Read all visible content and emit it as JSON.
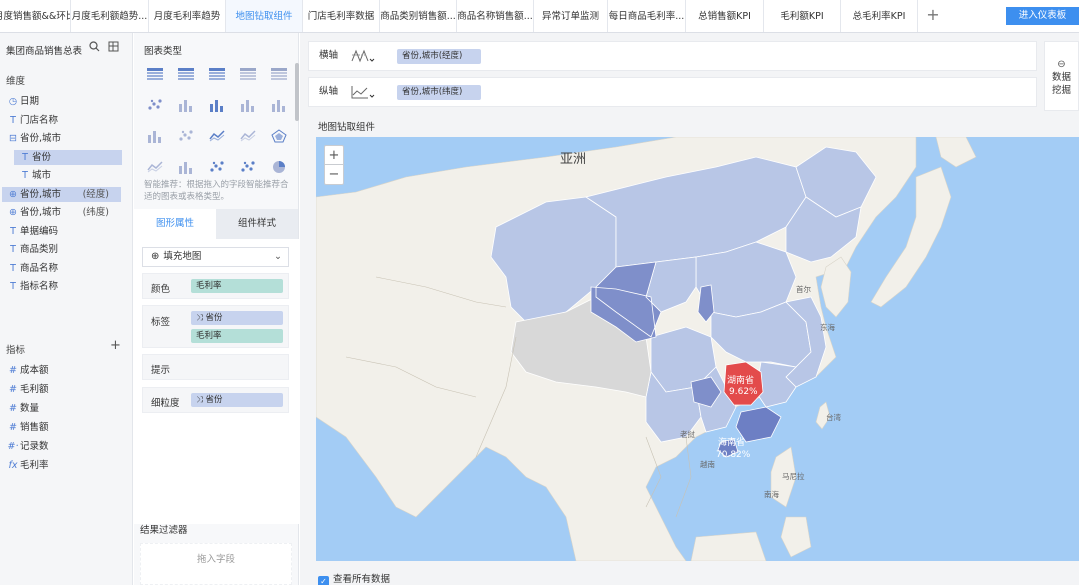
{
  "tabs": [
    {
      "label": "月度销售额&&环比",
      "active": false
    },
    {
      "label": "月度毛利额趋势...",
      "active": false
    },
    {
      "label": "月度毛利率趋势",
      "active": false
    },
    {
      "label": "地图钻取组件",
      "active": true
    },
    {
      "label": "门店毛利率数据",
      "active": false
    },
    {
      "label": "商品类别销售额...",
      "active": false
    },
    {
      "label": "商品名称销售额...",
      "active": false
    },
    {
      "label": "异常订单监测",
      "active": false
    },
    {
      "label": "每日商品毛利率...",
      "active": false
    },
    {
      "label": "总销售额KPI",
      "active": false
    },
    {
      "label": "毛利额KPI",
      "active": false
    },
    {
      "label": "总毛利率KPI",
      "active": false
    }
  ],
  "tab_add": "+",
  "enter_button": "进入仪表板",
  "left_panel": {
    "title": "集团商品销售总表",
    "dimension_header": "维度",
    "dimensions": [
      {
        "icon": "clock-icon",
        "glyph": "◷",
        "label": "日期",
        "indent": 0,
        "selected": false,
        "suffix": ""
      },
      {
        "icon": "text-type-icon",
        "glyph": "T",
        "label": "门店名称",
        "indent": 0,
        "selected": false,
        "suffix": ""
      },
      {
        "icon": "hierarchy-icon",
        "glyph": "⊟",
        "label": "省份,城市",
        "indent": 0,
        "selected": false,
        "suffix": ""
      },
      {
        "icon": "text-type-icon",
        "glyph": "T",
        "label": "省份",
        "indent": 1,
        "selected": true,
        "suffix": ""
      },
      {
        "icon": "text-type-icon",
        "glyph": "T",
        "label": "城市",
        "indent": 1,
        "selected": false,
        "suffix": ""
      },
      {
        "icon": "globe-icon",
        "glyph": "⊕",
        "label": "省份,城市",
        "indent": 0,
        "selected": true,
        "suffix": "(经度)"
      },
      {
        "icon": "globe-icon",
        "glyph": "⊕",
        "label": "省份,城市",
        "indent": 0,
        "selected": false,
        "suffix": "(纬度)"
      },
      {
        "icon": "text-type-icon",
        "glyph": "T",
        "label": "单据编码",
        "indent": 0,
        "selected": false,
        "suffix": ""
      },
      {
        "icon": "text-type-icon",
        "glyph": "T",
        "label": "商品类别",
        "indent": 0,
        "selected": false,
        "suffix": ""
      },
      {
        "icon": "text-type-icon",
        "glyph": "T",
        "label": "商品名称",
        "indent": 0,
        "selected": false,
        "suffix": ""
      },
      {
        "icon": "text-type-icon",
        "glyph": "T",
        "label": "指标名称",
        "indent": 0,
        "selected": false,
        "suffix": ""
      }
    ],
    "metric_header": "指标",
    "metric_add": "+",
    "metrics": [
      {
        "icon": "hash-icon",
        "glyph": "#",
        "label": "成本额"
      },
      {
        "icon": "hash-icon",
        "glyph": "#",
        "label": "毛利额"
      },
      {
        "icon": "hash-icon",
        "glyph": "#",
        "label": "数量"
      },
      {
        "icon": "hash-icon",
        "glyph": "#",
        "label": "销售额"
      },
      {
        "icon": "hash-icon",
        "glyph": "#·",
        "label": "记录数"
      },
      {
        "icon": "formula-icon",
        "glyph": "fx",
        "label": "毛利率"
      }
    ]
  },
  "middle_panel": {
    "chart_types_title": "图表类型",
    "hint": "智能推荐：根据拖入的字段智能推荐合适的图表或表格类型。",
    "tab_graph": "图形属性",
    "tab_component": "组件样式",
    "map_type": "填充地图",
    "color_label": "颜色",
    "color_field": "毛利率",
    "label_label": "标签",
    "label_fields": [
      "省份",
      "毛利率"
    ],
    "tooltip_label": "提示",
    "granularity_label": "细粒度",
    "granularity_field": "省份",
    "filter_title": "结果过滤器",
    "filter_placeholder": "拖入字段"
  },
  "right_area": {
    "x_axis_label": "横轴",
    "x_axis_field": "省份,城市(经度)",
    "y_axis_label": "纵轴",
    "y_axis_field": "省份,城市(纬度)",
    "data_mining": "数据挖掘",
    "chart_title": "地图钻取组件",
    "map": {
      "continent_label": "亚洲",
      "zoom_in": "+",
      "zoom_out": "−",
      "labels": [
        {
          "name": "湖南省",
          "value": "9.62%"
        },
        {
          "name": "海南省",
          "value": "70.82%"
        }
      ],
      "place_labels": [
        "首尔",
        "东海",
        "台湾",
        "马尼拉",
        "南海",
        "越南",
        "老挝"
      ]
    },
    "show_all_data": "查看所有数据"
  },
  "colors": {
    "accent": "#3d8fef",
    "province_light": "#b8c6e6",
    "province_mid": "#8c9fd6",
    "province_dark": "#5a6fbd",
    "province_highlight": "#e34b4b",
    "sea": "#a3ccf5",
    "land": "#f2f0ea",
    "pill_green": "#b4dfd8",
    "pill_blue": "#c7d3ee"
  }
}
